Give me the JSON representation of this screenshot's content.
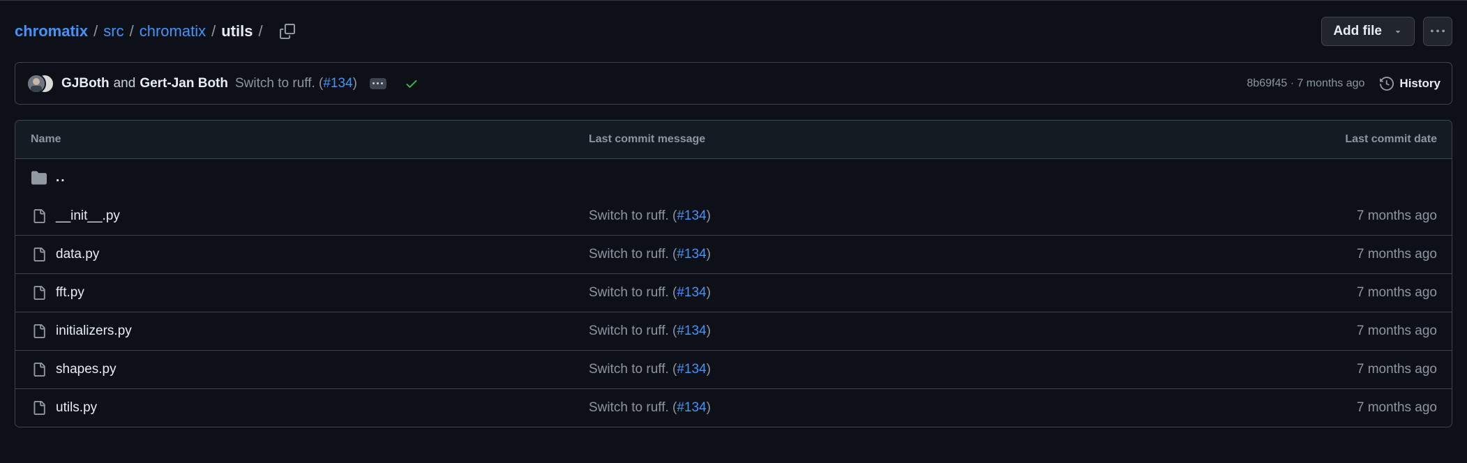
{
  "breadcrumb": {
    "repo": "chromatix",
    "parts": [
      "src",
      "chromatix"
    ],
    "current": "utils",
    "separator": "/"
  },
  "actions": {
    "add_file_label": "Add file"
  },
  "commit": {
    "author1": "GJBoth",
    "and_text": "and",
    "author2": "Gert-Jan Both",
    "message_prefix": "Switch to ruff. (",
    "pr": "#134",
    "message_suffix": ")",
    "sha_time": "8b69f45 · 7 months ago",
    "history_label": "History",
    "status_color": "#3fb950"
  },
  "table": {
    "headers": {
      "name": "Name",
      "message": "Last commit message",
      "date": "Last commit date"
    },
    "parent_dir": "..",
    "rows": [
      {
        "name": "__init__.py",
        "msg_prefix": "Switch to ruff. (",
        "pr": "#134",
        "msg_suffix": ")",
        "date": "7 months ago"
      },
      {
        "name": "data.py",
        "msg_prefix": "Switch to ruff. (",
        "pr": "#134",
        "msg_suffix": ")",
        "date": "7 months ago"
      },
      {
        "name": "fft.py",
        "msg_prefix": "Switch to ruff. (",
        "pr": "#134",
        "msg_suffix": ")",
        "date": "7 months ago"
      },
      {
        "name": "initializers.py",
        "msg_prefix": "Switch to ruff. (",
        "pr": "#134",
        "msg_suffix": ")",
        "date": "7 months ago"
      },
      {
        "name": "shapes.py",
        "msg_prefix": "Switch to ruff. (",
        "pr": "#134",
        "msg_suffix": ")",
        "date": "7 months ago"
      },
      {
        "name": "utils.py",
        "msg_prefix": "Switch to ruff. (",
        "pr": "#134",
        "msg_suffix": ")",
        "date": "7 months ago"
      }
    ]
  },
  "icons": {
    "copy": "copy-icon",
    "caret": "triangle-down-icon",
    "kebab": "kebab-horizontal-icon",
    "check": "check-icon",
    "history": "history-icon",
    "folder": "folder-icon",
    "file": "file-icon"
  },
  "colors": {
    "background": "#0d1117",
    "link": "#4493f8",
    "border": "#3d444d",
    "muted": "#8d96a0"
  }
}
